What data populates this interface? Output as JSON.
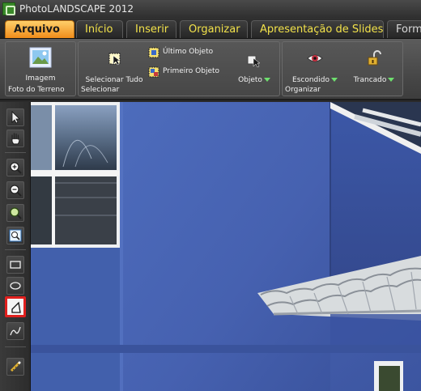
{
  "window": {
    "title": "PhotoLANDSCAPE 2012",
    "app_icon": "photolandscape-app-icon"
  },
  "tabs": [
    {
      "label": "Arquivo",
      "active": true
    },
    {
      "label": "Início"
    },
    {
      "label": "Inserir"
    },
    {
      "label": "Organizar"
    },
    {
      "label": "Apresentação de Slides"
    },
    {
      "label": "Form"
    }
  ],
  "ribbon": {
    "groups": {
      "foto_do_terreno": {
        "label": "Foto do Terreno",
        "image_button": {
          "label": "Imagem",
          "icon": "image-icon"
        }
      },
      "selecionar": {
        "label": "Selecionar",
        "select_all": {
          "label": "Selecionar Tudo",
          "icon": "select-all-icon"
        },
        "last_object": {
          "label": "Último Objeto",
          "icon": "last-object-icon"
        },
        "first_object": {
          "label": "Primeiro Objeto",
          "icon": "first-object-icon"
        },
        "object": {
          "label": "Objeto",
          "icon": "object-icon"
        }
      },
      "organizar": {
        "label": "Organizar",
        "hidden": {
          "label": "Escondido",
          "icon": "eye-icon"
        },
        "locked": {
          "label": "Trancado",
          "icon": "padlock-icon"
        }
      }
    },
    "dropdown_arrow_color": "#6ee06e"
  },
  "toolbar": {
    "tools": [
      {
        "name": "pointer-tool",
        "icon": "arrow-cursor-icon"
      },
      {
        "name": "pan-tool",
        "icon": "hand-icon"
      },
      {
        "name": "zoom-in-tool",
        "icon": "zoom-in-icon"
      },
      {
        "name": "zoom-out-tool",
        "icon": "zoom-out-icon"
      },
      {
        "name": "zoom-area-tool",
        "icon": "magnifier-icon"
      },
      {
        "name": "zoom-fit-tool",
        "icon": "zoom-fit-icon"
      },
      {
        "name": "rectangle-tool",
        "icon": "rectangle-icon"
      },
      {
        "name": "ellipse-tool",
        "icon": "ellipse-icon"
      },
      {
        "name": "polygon-tool",
        "icon": "polygon-icon",
        "selected": true
      },
      {
        "name": "curve-tool",
        "icon": "freeform-curve-icon"
      },
      {
        "name": "measure-tool",
        "icon": "measure-icon"
      }
    ],
    "selection_highlight": "#e0201e"
  },
  "canvas": {
    "content": "photo of blue house facade with window and tiled roof",
    "wall_color": "#4a66b4",
    "trim_color": "#f0f0f0"
  }
}
